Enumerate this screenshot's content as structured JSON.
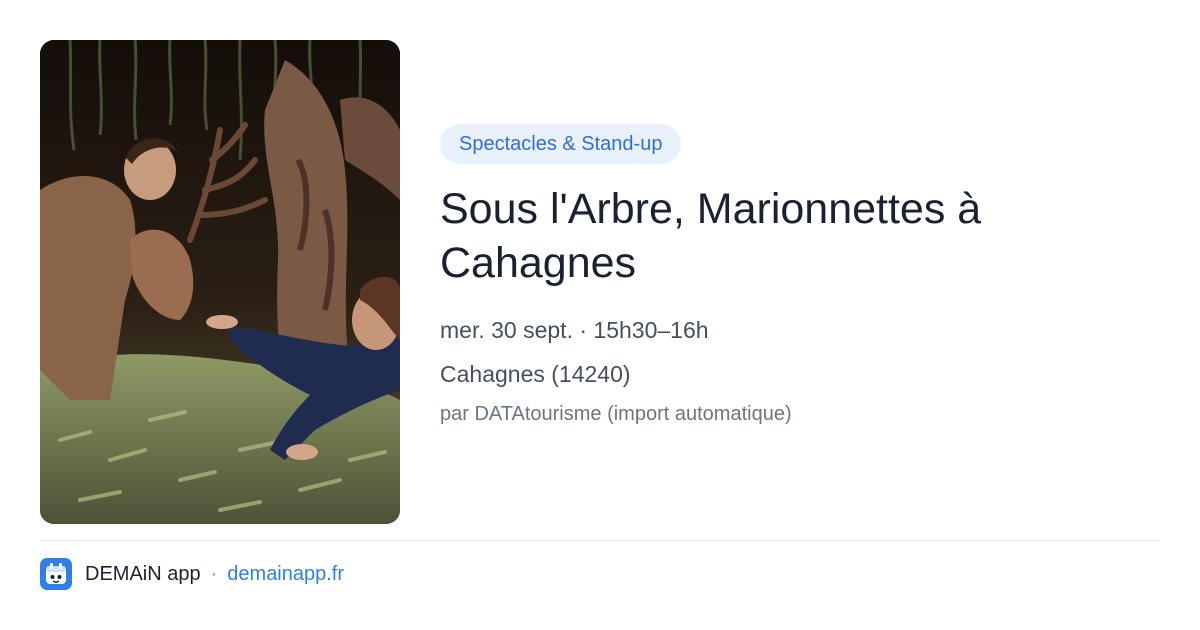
{
  "event": {
    "category": "Spectacles & Stand-up",
    "title": "Sous l'Arbre, Marionnettes à Cahagnes",
    "datetime": "mer. 30 sept. · 15h30–16h",
    "location": "Cahagnes (14240)",
    "source": "par DATAtourisme (import automatique)",
    "image": "puppet-show-photo"
  },
  "footer": {
    "app_name": "DEMAiN app",
    "separator": "·",
    "domain": "demainapp.fr",
    "icon": "calendar-app-icon"
  },
  "colors": {
    "accent": "#2f7fe6",
    "tag_bg": "#e9f1fc",
    "tag_text": "#2f6fd6",
    "title": "#1a2232",
    "meta": "#454f60",
    "muted": "#6b7585"
  }
}
